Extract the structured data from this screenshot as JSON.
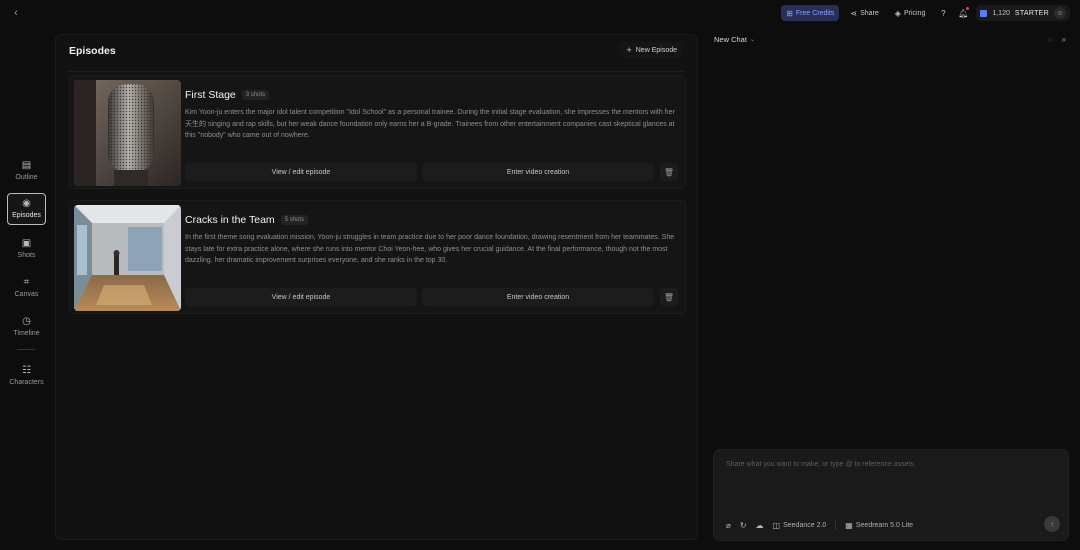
{
  "topbar": {
    "back_icon": "chevron-left-icon",
    "free_credits": "Free Credits",
    "share": "Share",
    "pricing": "Pricing",
    "credits_count": "1,120",
    "plan": "STARTER"
  },
  "rail": {
    "items": [
      {
        "label": "Outline",
        "icon": "outline-icon"
      },
      {
        "label": "Episodes",
        "icon": "episodes-icon",
        "active": true
      },
      {
        "label": "Shots",
        "icon": "shots-icon"
      },
      {
        "label": "Canvas",
        "icon": "canvas-icon"
      },
      {
        "label": "Timeline",
        "icon": "timeline-icon"
      },
      {
        "label": "Characters",
        "icon": "characters-icon"
      }
    ]
  },
  "episodes": {
    "title": "Episodes",
    "new_episode": "New Episode",
    "view_label": "View / edit episode",
    "video_label": "Enter video creation",
    "items": [
      {
        "title": "First Stage",
        "shots": "3 shots",
        "description": "Kim Yoon-ju enters the major idol talent competition \"Idol School\" as a personal trainee. During the initial stage evaluation, she impresses the mentors with her天生的 singing and rap skills, but her weak dance foundation only earns her a B-grade. Trainees from other entertainment companies cast skeptical glances at this \"nobody\" who came out of nowhere."
      },
      {
        "title": "Cracks in the Team",
        "shots": "5 shots",
        "description": "In the first theme song evaluation mission, Yoon-ju struggles in team practice due to her poor dance foundation, drawing resentment from her teammates. She stays late for extra practice alone, where she runs into mentor Choi Yeon-hee, who gives her crucial guidance. At the final performance, though not the most dazzling, her dramatic improvement surprises everyone, and she ranks in the top 30."
      }
    ]
  },
  "chat": {
    "title": "New Chat",
    "placeholder": "Share what you want to make, or type @ to reference assets",
    "model_video": "Seedance 2.0",
    "model_image": "Seedream 5.0 Lite"
  },
  "colors": {
    "background": "#0d0d0d",
    "panel": "#121212",
    "card": "#151515",
    "credits_accent": "#8ea2ff",
    "notification_dot": "#e0453c"
  }
}
